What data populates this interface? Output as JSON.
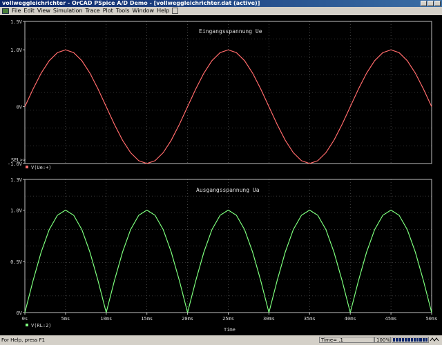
{
  "window": {
    "title": "vollweggleichrichter - OrCAD PSpice A/D Demo - [vollweggleichrichter.dat (active)]"
  },
  "menu": {
    "items": [
      "File",
      "Edit",
      "View",
      "Simulation",
      "Trace",
      "Plot",
      "Tools",
      "Window",
      "Help"
    ]
  },
  "plot": {
    "sel_marker": "SEL>>",
    "x_axis_label": "Time"
  },
  "status": {
    "help_text": "For Help, press F1",
    "time_text": "Time= .1",
    "zoom": "100%"
  },
  "colors": {
    "background": "#000000",
    "grid": "#6e6e6e",
    "text": "#dcdcdc",
    "trace_top": "#ff6a6a",
    "trace_bottom": "#7dff7d"
  },
  "chart_data": [
    {
      "type": "line",
      "title": "Eingangsspannung Ue",
      "trace_label": "V(Ue:+)",
      "xlabel": "",
      "xlim": [
        0,
        50
      ],
      "x_unit": "ms",
      "ylim": [
        -1.0,
        1.5
      ],
      "y_ticks": [
        -1.0,
        0,
        1.0,
        1.5
      ],
      "y_tick_labels": [
        "-1.0V",
        "0V",
        "1.0V",
        "1.5V"
      ],
      "grid": true,
      "series": [
        {
          "color": "#ff6a6a",
          "x": [
            0,
            1,
            2,
            3,
            4,
            5,
            6,
            7,
            8,
            9,
            10,
            11,
            12,
            13,
            14,
            15,
            16,
            17,
            18,
            19,
            20,
            21,
            22,
            23,
            24,
            25,
            26,
            27,
            28,
            29,
            30,
            31,
            32,
            33,
            34,
            35,
            36,
            37,
            38,
            39,
            40,
            41,
            42,
            43,
            44,
            45,
            46,
            47,
            48,
            49,
            50
          ],
          "values": [
            0,
            0.31,
            0.59,
            0.81,
            0.95,
            1.0,
            0.95,
            0.81,
            0.59,
            0.31,
            0,
            -0.31,
            -0.59,
            -0.81,
            -0.95,
            -1.0,
            -0.95,
            -0.81,
            -0.59,
            -0.31,
            0,
            0.31,
            0.59,
            0.81,
            0.95,
            1.0,
            0.95,
            0.81,
            0.59,
            0.31,
            0,
            -0.31,
            -0.59,
            -0.81,
            -0.95,
            -1.0,
            -0.95,
            -0.81,
            -0.59,
            -0.31,
            0,
            0.31,
            0.59,
            0.81,
            0.95,
            1.0,
            0.95,
            0.81,
            0.59,
            0.31,
            0
          ]
        }
      ]
    },
    {
      "type": "line",
      "title": "Ausgangsspannung Ua",
      "trace_label": "V(RL:2)",
      "xlabel": "Time",
      "xlim": [
        0,
        50
      ],
      "x_unit": "ms",
      "x_ticks": [
        0,
        5,
        10,
        15,
        20,
        25,
        30,
        35,
        40,
        45,
        50
      ],
      "x_tick_labels": [
        "0s",
        "5ms",
        "10ms",
        "15ms",
        "20ms",
        "25ms",
        "30ms",
        "35ms",
        "40ms",
        "45ms",
        "50ms"
      ],
      "ylim": [
        0,
        1.3
      ],
      "y_ticks": [
        0,
        0.5,
        1.0,
        1.3
      ],
      "y_tick_labels": [
        "0V",
        "0.5V",
        "1.0V",
        "1.3V"
      ],
      "grid": true,
      "series": [
        {
          "color": "#7dff7d",
          "x": [
            0,
            1,
            2,
            3,
            4,
            5,
            6,
            7,
            8,
            9,
            10,
            11,
            12,
            13,
            14,
            15,
            16,
            17,
            18,
            19,
            20,
            21,
            22,
            23,
            24,
            25,
            26,
            27,
            28,
            29,
            30,
            31,
            32,
            33,
            34,
            35,
            36,
            37,
            38,
            39,
            40,
            41,
            42,
            43,
            44,
            45,
            46,
            47,
            48,
            49,
            50
          ],
          "values": [
            0,
            0.31,
            0.59,
            0.81,
            0.95,
            1.0,
            0.95,
            0.81,
            0.59,
            0.31,
            0,
            0.31,
            0.59,
            0.81,
            0.95,
            1.0,
            0.95,
            0.81,
            0.59,
            0.31,
            0,
            0.31,
            0.59,
            0.81,
            0.95,
            1.0,
            0.95,
            0.81,
            0.59,
            0.31,
            0,
            0.31,
            0.59,
            0.81,
            0.95,
            1.0,
            0.95,
            0.81,
            0.59,
            0.31,
            0,
            0.31,
            0.59,
            0.81,
            0.95,
            1.0,
            0.95,
            0.81,
            0.59,
            0.31,
            0
          ]
        }
      ]
    }
  ]
}
